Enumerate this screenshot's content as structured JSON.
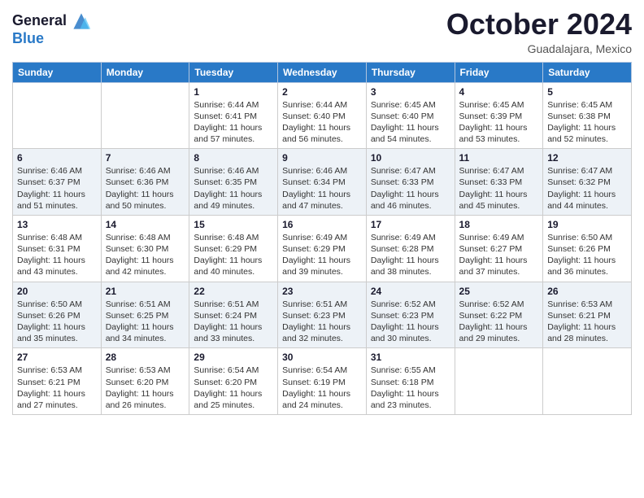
{
  "header": {
    "logo_line1": "General",
    "logo_line2": "Blue",
    "month": "October 2024",
    "location": "Guadalajara, Mexico"
  },
  "days_of_week": [
    "Sunday",
    "Monday",
    "Tuesday",
    "Wednesday",
    "Thursday",
    "Friday",
    "Saturday"
  ],
  "weeks": [
    [
      {
        "day": "",
        "sunrise": "",
        "sunset": "",
        "daylight": ""
      },
      {
        "day": "",
        "sunrise": "",
        "sunset": "",
        "daylight": ""
      },
      {
        "day": "1",
        "sunrise": "Sunrise: 6:44 AM",
        "sunset": "Sunset: 6:41 PM",
        "daylight": "Daylight: 11 hours and 57 minutes."
      },
      {
        "day": "2",
        "sunrise": "Sunrise: 6:44 AM",
        "sunset": "Sunset: 6:40 PM",
        "daylight": "Daylight: 11 hours and 56 minutes."
      },
      {
        "day": "3",
        "sunrise": "Sunrise: 6:45 AM",
        "sunset": "Sunset: 6:40 PM",
        "daylight": "Daylight: 11 hours and 54 minutes."
      },
      {
        "day": "4",
        "sunrise": "Sunrise: 6:45 AM",
        "sunset": "Sunset: 6:39 PM",
        "daylight": "Daylight: 11 hours and 53 minutes."
      },
      {
        "day": "5",
        "sunrise": "Sunrise: 6:45 AM",
        "sunset": "Sunset: 6:38 PM",
        "daylight": "Daylight: 11 hours and 52 minutes."
      }
    ],
    [
      {
        "day": "6",
        "sunrise": "Sunrise: 6:46 AM",
        "sunset": "Sunset: 6:37 PM",
        "daylight": "Daylight: 11 hours and 51 minutes."
      },
      {
        "day": "7",
        "sunrise": "Sunrise: 6:46 AM",
        "sunset": "Sunset: 6:36 PM",
        "daylight": "Daylight: 11 hours and 50 minutes."
      },
      {
        "day": "8",
        "sunrise": "Sunrise: 6:46 AM",
        "sunset": "Sunset: 6:35 PM",
        "daylight": "Daylight: 11 hours and 49 minutes."
      },
      {
        "day": "9",
        "sunrise": "Sunrise: 6:46 AM",
        "sunset": "Sunset: 6:34 PM",
        "daylight": "Daylight: 11 hours and 47 minutes."
      },
      {
        "day": "10",
        "sunrise": "Sunrise: 6:47 AM",
        "sunset": "Sunset: 6:33 PM",
        "daylight": "Daylight: 11 hours and 46 minutes."
      },
      {
        "day": "11",
        "sunrise": "Sunrise: 6:47 AM",
        "sunset": "Sunset: 6:33 PM",
        "daylight": "Daylight: 11 hours and 45 minutes."
      },
      {
        "day": "12",
        "sunrise": "Sunrise: 6:47 AM",
        "sunset": "Sunset: 6:32 PM",
        "daylight": "Daylight: 11 hours and 44 minutes."
      }
    ],
    [
      {
        "day": "13",
        "sunrise": "Sunrise: 6:48 AM",
        "sunset": "Sunset: 6:31 PM",
        "daylight": "Daylight: 11 hours and 43 minutes."
      },
      {
        "day": "14",
        "sunrise": "Sunrise: 6:48 AM",
        "sunset": "Sunset: 6:30 PM",
        "daylight": "Daylight: 11 hours and 42 minutes."
      },
      {
        "day": "15",
        "sunrise": "Sunrise: 6:48 AM",
        "sunset": "Sunset: 6:29 PM",
        "daylight": "Daylight: 11 hours and 40 minutes."
      },
      {
        "day": "16",
        "sunrise": "Sunrise: 6:49 AM",
        "sunset": "Sunset: 6:29 PM",
        "daylight": "Daylight: 11 hours and 39 minutes."
      },
      {
        "day": "17",
        "sunrise": "Sunrise: 6:49 AM",
        "sunset": "Sunset: 6:28 PM",
        "daylight": "Daylight: 11 hours and 38 minutes."
      },
      {
        "day": "18",
        "sunrise": "Sunrise: 6:49 AM",
        "sunset": "Sunset: 6:27 PM",
        "daylight": "Daylight: 11 hours and 37 minutes."
      },
      {
        "day": "19",
        "sunrise": "Sunrise: 6:50 AM",
        "sunset": "Sunset: 6:26 PM",
        "daylight": "Daylight: 11 hours and 36 minutes."
      }
    ],
    [
      {
        "day": "20",
        "sunrise": "Sunrise: 6:50 AM",
        "sunset": "Sunset: 6:26 PM",
        "daylight": "Daylight: 11 hours and 35 minutes."
      },
      {
        "day": "21",
        "sunrise": "Sunrise: 6:51 AM",
        "sunset": "Sunset: 6:25 PM",
        "daylight": "Daylight: 11 hours and 34 minutes."
      },
      {
        "day": "22",
        "sunrise": "Sunrise: 6:51 AM",
        "sunset": "Sunset: 6:24 PM",
        "daylight": "Daylight: 11 hours and 33 minutes."
      },
      {
        "day": "23",
        "sunrise": "Sunrise: 6:51 AM",
        "sunset": "Sunset: 6:23 PM",
        "daylight": "Daylight: 11 hours and 32 minutes."
      },
      {
        "day": "24",
        "sunrise": "Sunrise: 6:52 AM",
        "sunset": "Sunset: 6:23 PM",
        "daylight": "Daylight: 11 hours and 30 minutes."
      },
      {
        "day": "25",
        "sunrise": "Sunrise: 6:52 AM",
        "sunset": "Sunset: 6:22 PM",
        "daylight": "Daylight: 11 hours and 29 minutes."
      },
      {
        "day": "26",
        "sunrise": "Sunrise: 6:53 AM",
        "sunset": "Sunset: 6:21 PM",
        "daylight": "Daylight: 11 hours and 28 minutes."
      }
    ],
    [
      {
        "day": "27",
        "sunrise": "Sunrise: 6:53 AM",
        "sunset": "Sunset: 6:21 PM",
        "daylight": "Daylight: 11 hours and 27 minutes."
      },
      {
        "day": "28",
        "sunrise": "Sunrise: 6:53 AM",
        "sunset": "Sunset: 6:20 PM",
        "daylight": "Daylight: 11 hours and 26 minutes."
      },
      {
        "day": "29",
        "sunrise": "Sunrise: 6:54 AM",
        "sunset": "Sunset: 6:20 PM",
        "daylight": "Daylight: 11 hours and 25 minutes."
      },
      {
        "day": "30",
        "sunrise": "Sunrise: 6:54 AM",
        "sunset": "Sunset: 6:19 PM",
        "daylight": "Daylight: 11 hours and 24 minutes."
      },
      {
        "day": "31",
        "sunrise": "Sunrise: 6:55 AM",
        "sunset": "Sunset: 6:18 PM",
        "daylight": "Daylight: 11 hours and 23 minutes."
      },
      {
        "day": "",
        "sunrise": "",
        "sunset": "",
        "daylight": ""
      },
      {
        "day": "",
        "sunrise": "",
        "sunset": "",
        "daylight": ""
      }
    ]
  ]
}
